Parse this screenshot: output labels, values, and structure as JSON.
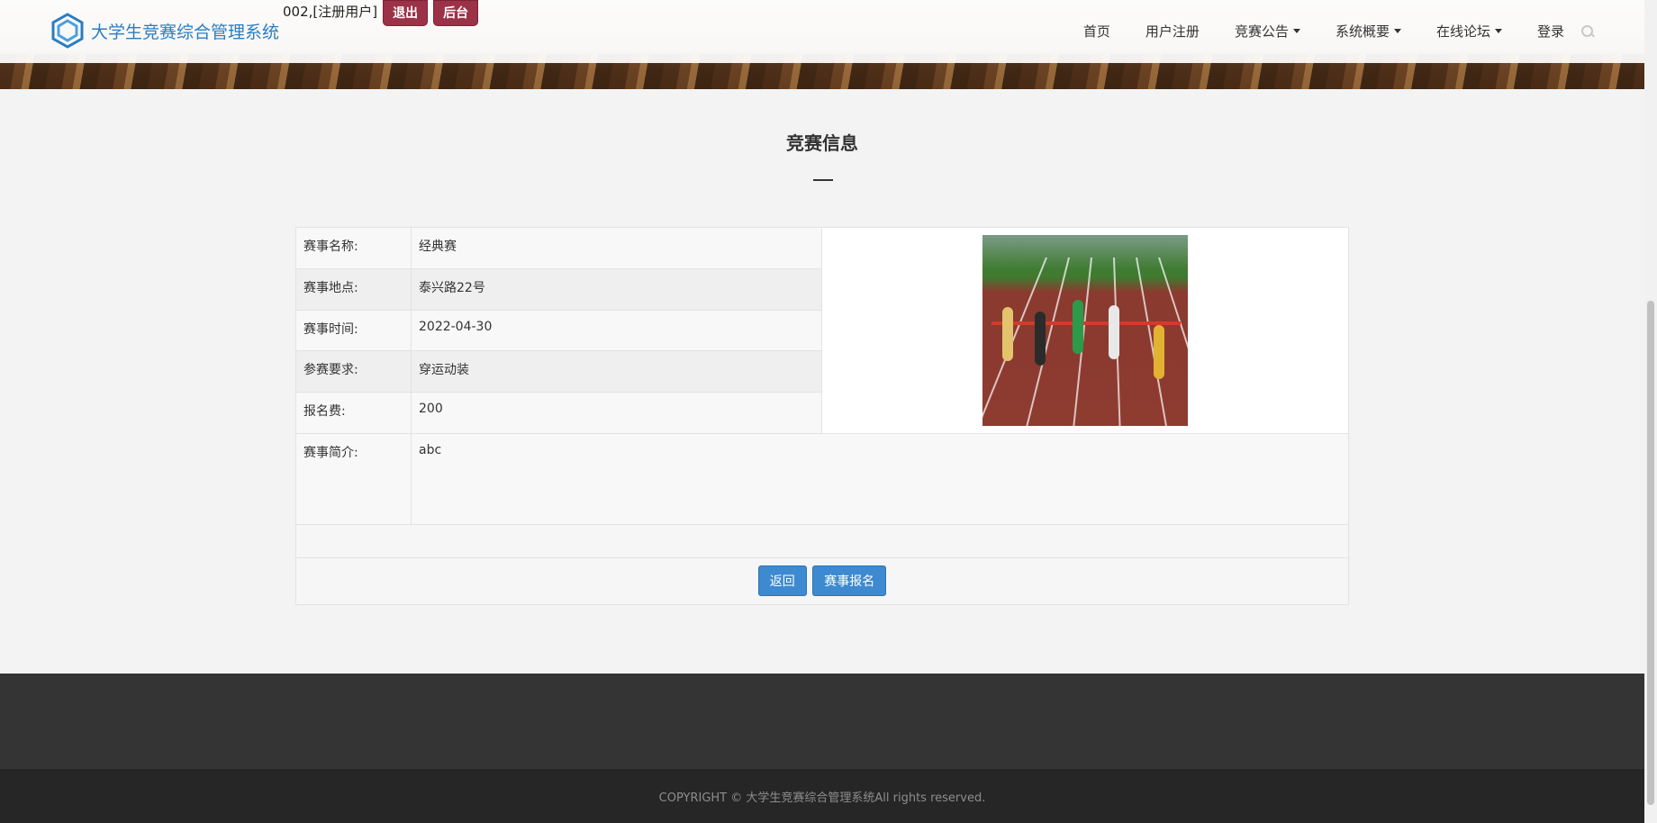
{
  "brand": {
    "name": "大学生竞赛综合管理系统"
  },
  "user": {
    "info": "002,[注册用户]",
    "logout_label": "退出",
    "admin_label": "后台"
  },
  "nav": {
    "home": "首页",
    "register": "用户注册",
    "announcements": "竞赛公告",
    "overview": "系统概要",
    "forum": "在线论坛",
    "login": "登录"
  },
  "section": {
    "title": "竞赛信息"
  },
  "details": {
    "rows": [
      {
        "label": "赛事名称:",
        "value": "经典赛"
      },
      {
        "label": "赛事地点:",
        "value": "泰兴路22号"
      },
      {
        "label": "赛事时间:",
        "value": "2022-04-30"
      },
      {
        "label": "参赛要求:",
        "value": "穿运动装"
      },
      {
        "label": "报名费:",
        "value": "200"
      }
    ],
    "intro_label": "赛事简介:",
    "intro_value": "abc",
    "image_alt": "hurdles race photo"
  },
  "actions": {
    "back_label": "返回",
    "signup_label": "赛事报名"
  },
  "footer": {
    "copyright": "COPYRIGHT © 大学生竞赛综合管理系统All rights reserved."
  },
  "colors": {
    "brand": "#2a7dc1",
    "accent_red": "#9b3247",
    "button_blue": "#3e8ad0"
  }
}
